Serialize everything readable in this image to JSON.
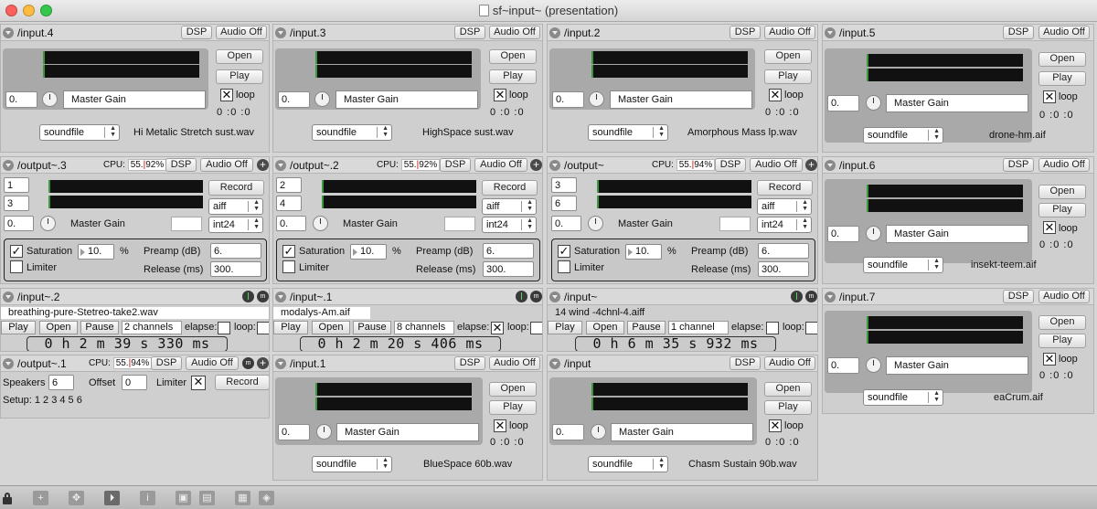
{
  "window": {
    "title": "sf~input~ (presentation)"
  },
  "common": {
    "dsp": "DSP",
    "audio_off": "Audio Off",
    "open": "Open",
    "play": "Play",
    "loop": "loop",
    "master_gain": "Master Gain",
    "gain_value": "0.",
    "time": "0 :0 :0",
    "soundfile": "soundfile",
    "record": "Record",
    "saturation": "Saturation",
    "limiter": "Limiter",
    "pct": "%",
    "preamp_label": "Preamp (dB)",
    "release_label": "Release (ms)",
    "cpu_label": "CPU:",
    "pause": "Pause",
    "elapse": "elapse:",
    "loop_colon": "loop:",
    "plus": "+",
    "m": "m",
    "check": "✕"
  },
  "inputs": {
    "in4": {
      "name": "/input.4",
      "file": "Hi Metalic Stretch sust.wav"
    },
    "in3": {
      "name": "/input.3",
      "file": "HighSpace sust.wav"
    },
    "in2": {
      "name": "/input.2",
      "file": "Amorphous Mass lp.wav"
    },
    "in5": {
      "name": "/input.5",
      "file": "drone-hm.aif"
    },
    "in6": {
      "name": "/input.6",
      "file": "insekt-teem.aif"
    },
    "in7": {
      "name": "/input.7",
      "file": "eaCrum.aif"
    },
    "in1": {
      "name": "/input.1",
      "file": "BlueSpace 60b.wav"
    },
    "in0": {
      "name": "/input",
      "file": "Chasm Sustain 90b.wav"
    }
  },
  "outputs": {
    "o3": {
      "name": "/output~.3",
      "cpu_a": "55.",
      "cpu_b": "92%",
      "ch1": "1",
      "ch2": "3",
      "format": "aiff",
      "depth": "int24",
      "sat": "10.",
      "preamp": "6.",
      "release": "300."
    },
    "o2": {
      "name": "/output~.2",
      "cpu_a": "55.",
      "cpu_b": "92%",
      "ch1": "2",
      "ch2": "4",
      "format": "aiff",
      "depth": "int24",
      "sat": "10.",
      "preamp": "6.",
      "release": "300."
    },
    "o0": {
      "name": "/output~",
      "cpu_a": "55.",
      "cpu_b": "94%",
      "ch1": "3",
      "ch2": "6",
      "format": "aiff",
      "depth": "int24",
      "sat": "10.",
      "preamp": "6.",
      "release": "300."
    },
    "o1": {
      "name": "/output~.1",
      "cpu_a": "55.",
      "cpu_b": "94%",
      "speakers_label": "Speakers",
      "speakers": "6",
      "offset_label": "Offset",
      "offset": "0",
      "limiter_label": "Limiter",
      "setup": "Setup: 1 2 3 4 5 6"
    }
  },
  "players": {
    "p2": {
      "name": "/input~.2",
      "file": "breathing-pure-Stetreo-take2.wav",
      "channels": "2 channels",
      "time": "0 h 2  m 39 s 330  ms"
    },
    "p1": {
      "name": "/input~.1",
      "file": "modalys-Am.aif",
      "channels": "8 channels",
      "time": "0 h 2  m 20 s 406  ms"
    },
    "p0": {
      "name": "/input~",
      "file": "14 wind -4chnl-4.aiff",
      "channels": "1 channel",
      "time": "0 h 6  m 35 s 932  ms"
    }
  },
  "toolbar": {
    "info": "i"
  }
}
